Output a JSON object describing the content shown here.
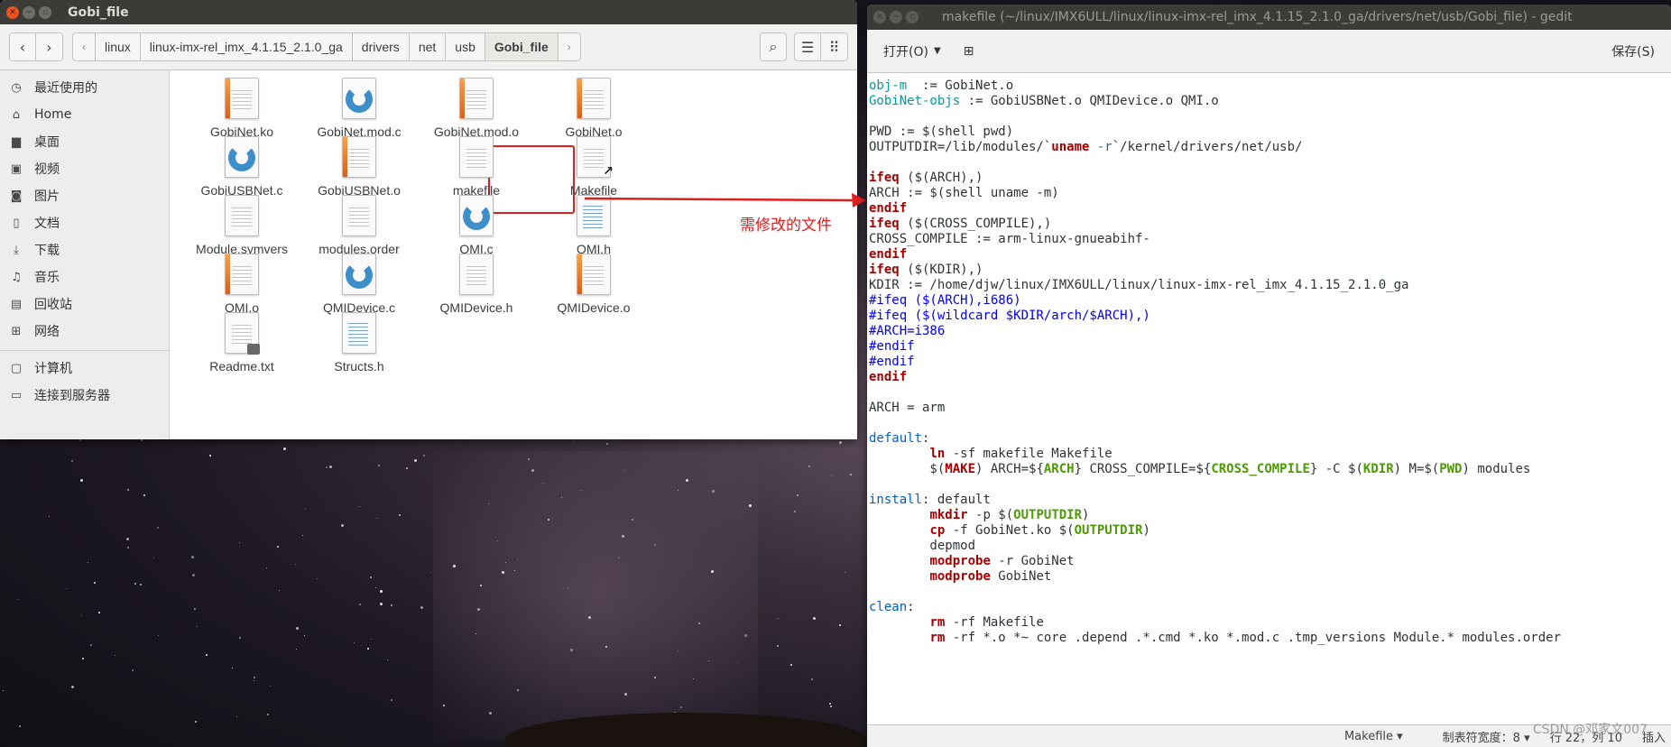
{
  "file_manager": {
    "title": "Gobi_file",
    "breadcrumbs": [
      "linux",
      "linux-imx-rel_imx_4.1.15_2.1.0_ga",
      "drivers",
      "net",
      "usb",
      "Gobi_file"
    ],
    "sidebar": [
      {
        "icon": "clock-icon",
        "glyph": "◷",
        "label": "最近使用的"
      },
      {
        "icon": "home-icon",
        "glyph": "⌂",
        "label": "Home"
      },
      {
        "icon": "folder-icon",
        "glyph": "▆",
        "label": "桌面"
      },
      {
        "icon": "video-icon",
        "glyph": "▣",
        "label": "视频"
      },
      {
        "icon": "camera-icon",
        "glyph": "◙",
        "label": "图片"
      },
      {
        "icon": "document-icon",
        "glyph": "▯",
        "label": "文档"
      },
      {
        "icon": "download-icon",
        "glyph": "⤓",
        "label": "下载"
      },
      {
        "icon": "music-icon",
        "glyph": "♫",
        "label": "音乐"
      },
      {
        "icon": "trash-icon",
        "glyph": "▤",
        "label": "回收站"
      },
      {
        "icon": "network-icon",
        "glyph": "⊞",
        "label": "网络"
      },
      {
        "icon": "computer-icon",
        "glyph": "▢",
        "label": "计算机"
      },
      {
        "icon": "server-icon",
        "glyph": "▭",
        "label": "连接到服务器"
      }
    ],
    "files": [
      {
        "name": "GobiNet.ko",
        "kind": "binary"
      },
      {
        "name": "GobiNet.mod.c",
        "kind": "c"
      },
      {
        "name": "GobiNet.mod.o",
        "kind": "binary"
      },
      {
        "name": "GobiNet.o",
        "kind": "binary"
      },
      {
        "name": "GobiUSBNet.c",
        "kind": "c"
      },
      {
        "name": "GobiUSBNet.o",
        "kind": "binary"
      },
      {
        "name": "makefile",
        "kind": "text"
      },
      {
        "name": "Makefile",
        "kind": "link"
      },
      {
        "name": "Module.symvers",
        "kind": "text"
      },
      {
        "name": "modules.order",
        "kind": "text"
      },
      {
        "name": "QMI.c",
        "kind": "c"
      },
      {
        "name": "QMI.h",
        "kind": "h"
      },
      {
        "name": "QMI.o",
        "kind": "binary"
      },
      {
        "name": "QMIDevice.c",
        "kind": "c"
      },
      {
        "name": "QMIDevice.h",
        "kind": "text"
      },
      {
        "name": "QMIDevice.o",
        "kind": "binary"
      },
      {
        "name": "Readme.txt",
        "kind": "locked"
      },
      {
        "name": "Structs.h",
        "kind": "h"
      }
    ]
  },
  "annotation": {
    "text": "需修改的文件",
    "color": "#e01e1e"
  },
  "gedit": {
    "title": "makefile (~/linux/IMX6ULL/linux/linux-imx-rel_imx_4.1.15_2.1.0_ga/drivers/net/usb/Gobi_file) - gedit",
    "open_label": "打开(O)",
    "save_label": "保存(S)",
    "status": {
      "language": "Makefile",
      "tab_width": "制表符宽度：8",
      "position": "行 22，列 10",
      "insert_mode": "插入"
    },
    "code_lines": [
      [
        [
          "var",
          "obj-m"
        ],
        [
          "",
          "  := GobiNet.o"
        ]
      ],
      [
        [
          "var",
          "GobiNet-objs"
        ],
        [
          "",
          " := GobiUSBNet.o QMIDevice.o QMI.o"
        ]
      ],
      [],
      [
        [
          "",
          "PWD := $(shell pwd)"
        ]
      ],
      [
        [
          "",
          "OUTPUTDIR=/lib/modules/`"
        ],
        [
          "kw",
          "uname"
        ],
        [
          "pp",
          " -r"
        ],
        [
          "",
          "`/kernel/drivers/net/usb/"
        ]
      ],
      [],
      [
        [
          "kw",
          "ifeq"
        ],
        [
          "",
          " ($(ARCH),)"
        ]
      ],
      [
        [
          "",
          "ARCH := $(shell uname -m)"
        ]
      ],
      [
        [
          "kw",
          "endif"
        ]
      ],
      [
        [
          "kw",
          "ifeq"
        ],
        [
          "",
          " ($(CROSS_COMPILE),)"
        ]
      ],
      [
        [
          "",
          "CROSS_COMPILE := arm-linux-gnueabihf-"
        ]
      ],
      [
        [
          "kw",
          "endif"
        ]
      ],
      [
        [
          "kw",
          "ifeq"
        ],
        [
          "",
          " ($(KDIR),)"
        ]
      ],
      [
        [
          "",
          "KDIR := /home/djw/linux/IMX6ULL/linux/linux-imx-rel_imx_4.1.15_2.1.0_ga"
        ]
      ],
      [
        [
          "cm",
          "#ifeq ($(ARCH),i686)"
        ]
      ],
      [
        [
          "cm",
          "#ifeq ($(wildcard $KDIR/arch/$ARCH),)"
        ]
      ],
      [
        [
          "cm",
          "#ARCH=i386"
        ]
      ],
      [
        [
          "cm",
          "#endif"
        ]
      ],
      [
        [
          "cm",
          "#endif"
        ]
      ],
      [
        [
          "kw",
          "endif"
        ]
      ],
      [],
      [
        [
          "",
          "ARCH = arm"
        ]
      ],
      [],
      [
        [
          "tg",
          "default"
        ],
        [
          "",
          ":"
        ]
      ],
      [
        [
          "",
          "        "
        ],
        [
          "kw",
          "ln"
        ],
        [
          "",
          " -sf makefile Makefile"
        ]
      ],
      [
        [
          "",
          "        $("
        ],
        [
          "kw",
          "MAKE"
        ],
        [
          "",
          ") ARCH=${"
        ],
        [
          "gr",
          "ARCH"
        ],
        [
          "",
          "} CROSS_COMPILE=${"
        ],
        [
          "gr",
          "CROSS_COMPILE"
        ],
        [
          "",
          "} -C $("
        ],
        [
          "gr",
          "KDIR"
        ],
        [
          "",
          ") M=$("
        ],
        [
          "gr",
          "PWD"
        ],
        [
          "",
          ") modules"
        ]
      ],
      [],
      [
        [
          "tg",
          "install"
        ],
        [
          "",
          ": default"
        ]
      ],
      [
        [
          "",
          "        "
        ],
        [
          "kw",
          "mkdir"
        ],
        [
          "",
          " -p $("
        ],
        [
          "gr",
          "OUTPUTDIR"
        ],
        [
          "",
          ")"
        ]
      ],
      [
        [
          "",
          "        "
        ],
        [
          "kw",
          "cp"
        ],
        [
          "",
          " -f GobiNet.ko $("
        ],
        [
          "gr",
          "OUTPUTDIR"
        ],
        [
          "",
          ")"
        ]
      ],
      [
        [
          "",
          "        depmod"
        ]
      ],
      [
        [
          "",
          "        "
        ],
        [
          "kw",
          "modprobe"
        ],
        [
          "",
          " -r GobiNet"
        ]
      ],
      [
        [
          "",
          "        "
        ],
        [
          "kw",
          "modprobe"
        ],
        [
          "",
          " GobiNet"
        ]
      ],
      [],
      [
        [
          "tg",
          "clean"
        ],
        [
          "",
          ":"
        ]
      ],
      [
        [
          "",
          "        "
        ],
        [
          "kw",
          "rm"
        ],
        [
          "",
          " -rf Makefile"
        ]
      ],
      [
        [
          "",
          "        "
        ],
        [
          "kw",
          "rm"
        ],
        [
          "",
          " -rf *.o *~ core .depend .*.cmd *.ko *.mod.c .tmp_versions Module.* modules.order"
        ]
      ]
    ]
  },
  "watermark": "CSDN @邓家文007"
}
